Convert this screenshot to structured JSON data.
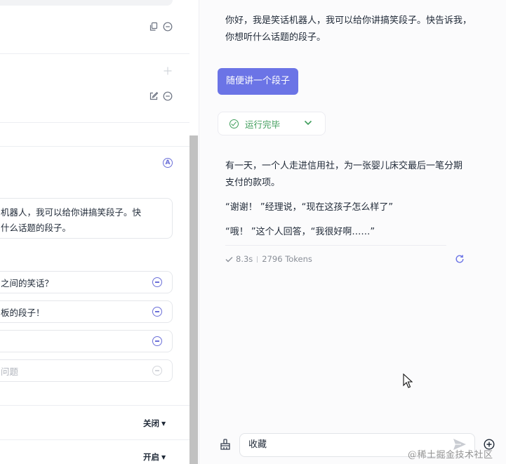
{
  "left": {
    "opening_text_line1": "机器人，我可以给你讲搞笑段子。快",
    "opening_text_line2": "什么话题的段子。",
    "badge": "A",
    "questions": [
      "之间的笑话？",
      "板的段子！",
      "",
      "问题"
    ],
    "toggle_close": "关闭",
    "toggle_open": "开启"
  },
  "chat": {
    "bot_greeting": "你好，我是笑话机器人，我可以给你讲搞笑段子。快告诉我，你想听什么话题的段子。",
    "user_message": "随便讲一个段子",
    "run_status": "运行完毕",
    "answer": [
      "有一天，一个人走进信用社，为一张婴儿床交最后一笔分期支付的款项。",
      "“谢谢！ ”经理说，“现在这孩子怎么样了”",
      "“哦！ ”这个人回答，“我很好啊……”"
    ],
    "time": "8.3s",
    "tokens": "2796 Tokens",
    "input_value": "收藏"
  },
  "watermark": "@稀土掘金技术社区",
  "colors": {
    "accent": "#6b74e6",
    "success": "#3f9d5b",
    "badge": "#6b6fd8"
  },
  "icons": [
    "copy-icon",
    "remove-icon",
    "plus-icon",
    "edit-icon",
    "check-circle-icon",
    "chevron-down-icon",
    "check-icon",
    "refresh-icon",
    "broom-icon",
    "send-icon",
    "add-circle-icon",
    "mouse-cursor-icon"
  ]
}
